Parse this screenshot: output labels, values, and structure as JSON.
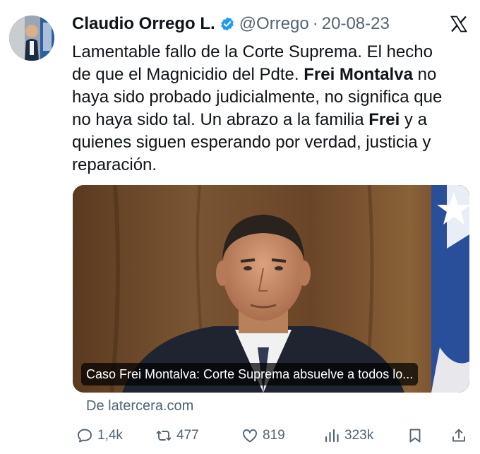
{
  "tweet": {
    "author_name": "Claudio Orrego L.",
    "handle": "@Orrego",
    "separator": "·",
    "date": "20-08-23",
    "text_lines": [
      [
        "Lamentable fallo de la Corte Suprema. El hecho"
      ],
      [
        "de que el Magnicidio del Pdte. ",
        "Frei Montalva",
        " no"
      ],
      [
        "haya sido probado judicialmente, no significa que"
      ],
      [
        "no haya sido tal. Un abrazo a la familia ",
        "Frei",
        " y a"
      ],
      [
        "quienes siguen esperando por verdad, justicia y"
      ],
      [
        "reparación."
      ]
    ]
  },
  "card": {
    "title": "Caso Frei Montalva: Corte Suprema absuelve a todos lo...",
    "source": "De latercera.com"
  },
  "actions": {
    "replies": "1,4k",
    "reposts": "477",
    "likes": "819",
    "views": "323k"
  },
  "icons": {
    "verified": "verified-badge-icon",
    "platform": "x-logo-icon",
    "reply": "reply-icon",
    "repost": "repost-icon",
    "like": "heart-icon",
    "views": "views-icon",
    "bookmark": "bookmark-icon",
    "share": "share-icon"
  },
  "colors": {
    "text": "#0f1419",
    "secondary": "#536471",
    "verified": "#1d9bf0"
  }
}
